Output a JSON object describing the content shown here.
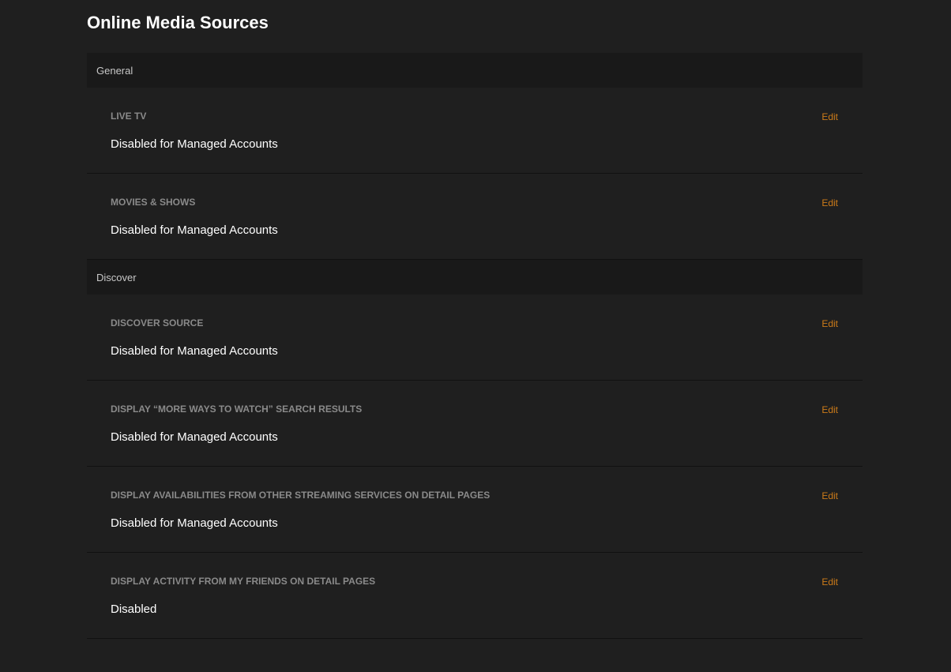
{
  "page": {
    "title": "Online Media Sources"
  },
  "colors": {
    "background": "#1f1f1f",
    "section_header_bg": "#191919",
    "accent": "#cc7b19",
    "label": "#8a8a8a",
    "value": "#ffffff"
  },
  "sections": [
    {
      "header": "General",
      "items": [
        {
          "label": "LIVE TV",
          "value": "Disabled for Managed Accounts",
          "action": "Edit"
        },
        {
          "label": "MOVIES & SHOWS",
          "value": "Disabled for Managed Accounts",
          "action": "Edit"
        }
      ]
    },
    {
      "header": "Discover",
      "items": [
        {
          "label": "DISCOVER SOURCE",
          "value": "Disabled for Managed Accounts",
          "action": "Edit"
        },
        {
          "label": "DISPLAY “MORE WAYS TO WATCH” SEARCH RESULTS",
          "value": "Disabled for Managed Accounts",
          "action": "Edit"
        },
        {
          "label": "DISPLAY AVAILABILITIES FROM OTHER STREAMING SERVICES ON DETAIL PAGES",
          "value": "Disabled for Managed Accounts",
          "action": "Edit"
        },
        {
          "label": "DISPLAY ACTIVITY FROM MY FRIENDS ON DETAIL PAGES",
          "value": "Disabled",
          "action": "Edit"
        }
      ]
    }
  ]
}
